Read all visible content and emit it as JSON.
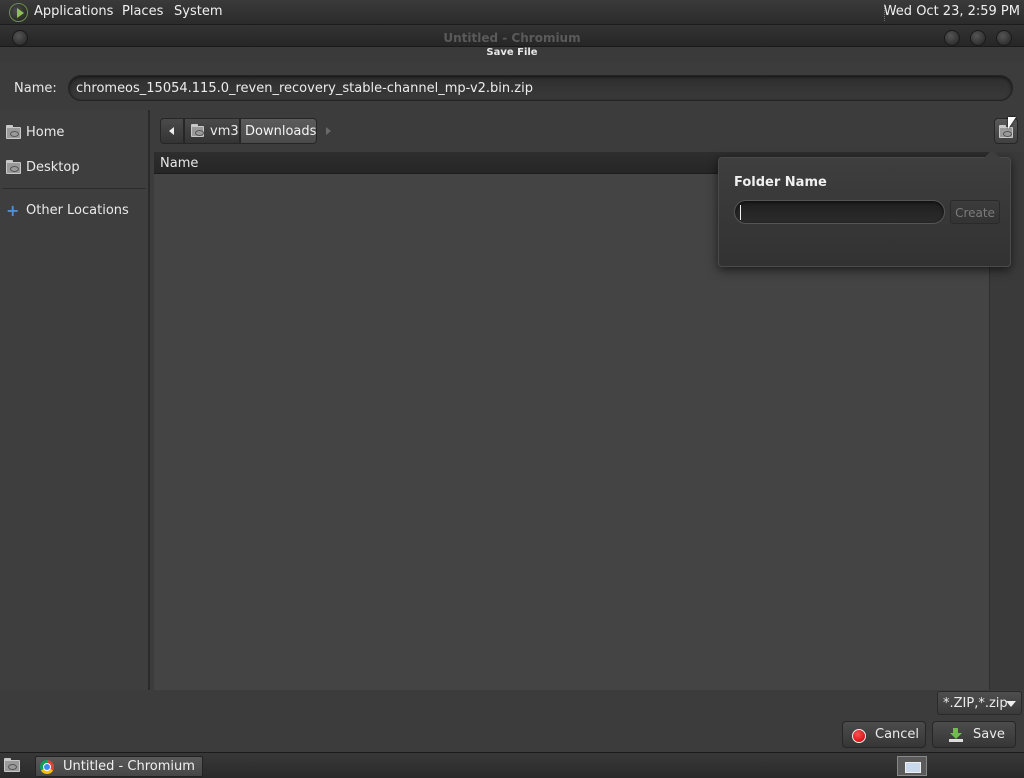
{
  "top_panel": {
    "menus": [
      "Applications",
      "Places",
      "System"
    ],
    "clock": "Wed Oct 23,  2:59 PM"
  },
  "window": {
    "title": "Untitled - Chromium"
  },
  "dialog": {
    "title": "Save File",
    "name_label": "Name:",
    "filename": "chromeos_15054.115.0_reven_recovery_stable-channel_mp-v2.bin.zip"
  },
  "sidebar": {
    "items": [
      {
        "label": "Home",
        "icon": "folder-home-icon"
      },
      {
        "label": "Desktop",
        "icon": "folder-desktop-icon"
      },
      {
        "label": "Other Locations",
        "icon": "plus-icon"
      }
    ]
  },
  "pathbar": {
    "segments": [
      "vm3",
      "Downloads"
    ]
  },
  "file_list": {
    "column_name": "Name"
  },
  "new_folder_popover": {
    "label": "Folder Name",
    "input_value": "",
    "create_label": "Create"
  },
  "filter": {
    "selected": "*.ZIP,*.zip"
  },
  "buttons": {
    "cancel": "Cancel",
    "save": "Save"
  },
  "taskbar": {
    "task_label": "Untitled - Chromium"
  }
}
